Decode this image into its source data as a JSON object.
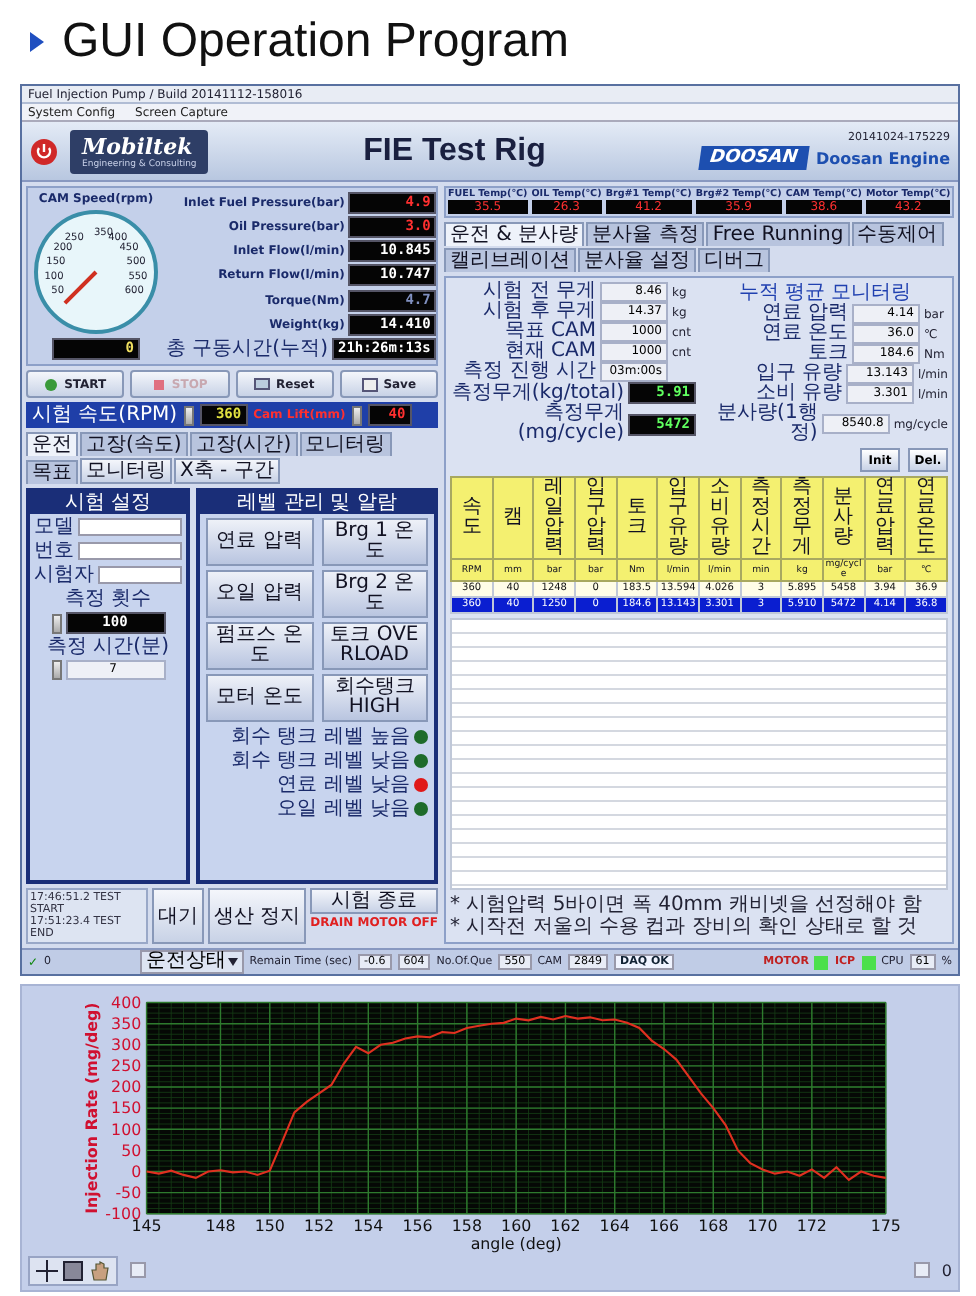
{
  "slide_title": "GUI Operation Program",
  "window": {
    "title": "Fuel Injection Pump / Build 20141112-158016",
    "menu": [
      "System Config",
      "Screen Capture"
    ],
    "brand": "Mobiltek",
    "brand_sub": "Engineering & Consulting",
    "heading": "FIE Test Rig",
    "partner_logo": "DOOSAN",
    "partner": "Doosan Engine",
    "timestamp": "20141024-175229"
  },
  "gauge": {
    "label": "CAM Speed(rpm)",
    "ticks": [
      "350",
      "250",
      "400",
      "200",
      "450",
      "150",
      "500",
      "100",
      "550",
      "50",
      "600"
    ],
    "reading": "0"
  },
  "readouts": [
    {
      "label": "Inlet Fuel Pressure(bar)",
      "value": "4.9",
      "kind": "warning"
    },
    {
      "label": "Oil Pressure(bar)",
      "value": "3.0",
      "kind": "warning"
    },
    {
      "label": "Inlet Flow(l/min)",
      "value": "10.845",
      "kind": "normal"
    },
    {
      "label": "Return Flow(l/min)",
      "value": "10.747",
      "kind": "normal"
    },
    {
      "label": "Torque(Nm)",
      "value": "4.7",
      "kind": "idle"
    },
    {
      "label": "Weight(kg)",
      "value": "14.410",
      "kind": "normal"
    }
  ],
  "run_time": {
    "label": "총 구동시간(누적)",
    "value": "21h:26m:13s"
  },
  "controls": [
    {
      "label": "START",
      "kind": "start",
      "disabled": false
    },
    {
      "label": "STOP",
      "kind": "stop",
      "disabled": true
    },
    {
      "label": "Reset",
      "kind": "reset",
      "disabled": false
    },
    {
      "label": "Save",
      "kind": "save",
      "disabled": false
    }
  ],
  "speed": {
    "label": "시험 속도(RPM)",
    "value": "360",
    "cam_label": "Cam Lift(mm)",
    "cam_value": "40"
  },
  "left_tabs": [
    {
      "label": "운전",
      "selected": true
    },
    {
      "label": "고장(속도)",
      "selected": false
    },
    {
      "label": "고장(시간)",
      "selected": false
    },
    {
      "label": "모니터링",
      "selected": false
    },
    {
      "label": "목표",
      "selected": false
    }
  ],
  "left_buttons": [
    "모니터링",
    "X축 - 구간"
  ],
  "test_setup": {
    "title": "시험 설정",
    "fields": [
      "모델",
      "번호",
      "시험자"
    ],
    "count_label": "측정 횟수",
    "count": "100",
    "time_label": "측정 시간(분)",
    "time": "7"
  },
  "alarms": {
    "title": "레벨 관리 및 알람",
    "buttons": [
      "연료 압력",
      "Brg 1 온도",
      "오일 압력",
      "Brg 2 온도",
      "펌프스 온도",
      "토크 OVERLOAD",
      "모터 온도",
      "회수탱크 HIGH"
    ],
    "lamps": [
      {
        "label": "회수 탱크 레벨 높음",
        "color": "#1e6b2a"
      },
      {
        "label": "회수 탱크 레벨 낮음",
        "color": "#1e6b2a"
      },
      {
        "label": "연료 레벨 낮음",
        "color": "#e01818"
      },
      {
        "label": "오일 레벨 낮음",
        "color": "#1e6b2a"
      }
    ]
  },
  "log": [
    "17:46:51.2 TEST START",
    "17:51:23.4 TEST END"
  ],
  "log_buttons": [
    "대기",
    "생산 정지"
  ],
  "finish_button": "시험 종료",
  "drain": "DRAIN MOTOR OFF",
  "temps": [
    {
      "label": "FUEL Temp(℃)",
      "value": "35.5"
    },
    {
      "label": "OIL Temp(℃)",
      "value": "26.3"
    },
    {
      "label": "Brg#1 Temp(℃)",
      "value": "41.2"
    },
    {
      "label": "Brg#2 Temp(℃)",
      "value": "35.9"
    },
    {
      "label": "CAM Temp(℃)",
      "value": "38.6"
    },
    {
      "label": "Motor Temp(℃)",
      "value": "43.2"
    }
  ],
  "right_tabs": [
    {
      "label": "운전 & 분사량",
      "selected": true
    },
    {
      "label": "분사율 측정",
      "selected": false
    },
    {
      "label": "Free Running",
      "selected": false
    },
    {
      "label": "수동제어",
      "selected": false
    },
    {
      "label": "캘리브레이션",
      "selected": false
    },
    {
      "label": "분사율 설정",
      "selected": false
    },
    {
      "label": "디버그",
      "selected": false
    }
  ],
  "measure": [
    {
      "label": "시험 전 무게",
      "value": "8.46",
      "unit": "kg"
    },
    {
      "label": "시험 후 무게",
      "value": "14.37",
      "unit": "kg"
    },
    {
      "label": "목표 CAM",
      "value": "1000",
      "unit": "cnt"
    },
    {
      "label": "현재 CAM",
      "value": "1000",
      "unit": "cnt"
    },
    {
      "label": "측정 진행 시간",
      "value": "03m:00s"
    }
  ],
  "results": [
    {
      "label": "측정무게(kg/total)",
      "value": "5.91"
    },
    {
      "label": "측정무게(mg/cycle)",
      "value": "5472"
    }
  ],
  "average": {
    "title": "누적 평균 모니터링",
    "rows": [
      {
        "label": "연료 압력",
        "value": "4.14",
        "unit": "bar"
      },
      {
        "label": "연료 온도",
        "value": "36.0",
        "unit": "℃"
      },
      {
        "label": "토크",
        "value": "184.6",
        "unit": "Nm"
      },
      {
        "label": "입구 유량",
        "value": "13.143",
        "unit": "l/min"
      },
      {
        "label": "소비 유량",
        "value": "3.301",
        "unit": "l/min"
      },
      {
        "label": "분사량(1행정)",
        "value": "8540.8",
        "unit": "mg/cycle"
      }
    ]
  },
  "table_buttons": [
    "Init",
    "Del."
  ],
  "table": {
    "columns": [
      {
        "name": "속도",
        "unit": "RPM"
      },
      {
        "name": "캠",
        "unit": "mm"
      },
      {
        "name": "레일압력",
        "unit": "bar"
      },
      {
        "name": "입구압력",
        "unit": "bar"
      },
      {
        "name": "토크",
        "unit": "Nm"
      },
      {
        "name": "입구유량",
        "unit": "l/min"
      },
      {
        "name": "소비유량",
        "unit": "l/min"
      },
      {
        "name": "측정시간",
        "unit": "min"
      },
      {
        "name": "측정무게",
        "unit": "kg"
      },
      {
        "name": "분사량",
        "unit": "mg/cycle"
      },
      {
        "name": "연료압력",
        "unit": "bar"
      },
      {
        "name": "연료온도",
        "unit": "℃"
      }
    ],
    "rows": [
      {
        "selected": false,
        "cells": [
          "360",
          "40",
          "1248",
          "0",
          "183.5",
          "13.594",
          "4.026",
          "3",
          "5.895",
          "5458",
          "3.94",
          "36.9"
        ]
      },
      {
        "selected": true,
        "cells": [
          "360",
          "40",
          "1250",
          "0",
          "184.6",
          "13.143",
          "3.301",
          "3",
          "5.910",
          "5472",
          "4.14",
          "36.8"
        ]
      }
    ]
  },
  "notes": [
    "* 시험압력 5바이면 폭 40mm 캐비넷을 선정해야 함",
    "* 시작전 저울의 수용 컵과 장비의 확인 상태로 할 것"
  ],
  "status_bar": {
    "state_menu": "운전상태",
    "remain_label": "Remain Time (sec)",
    "remain": "-0.6",
    "count": "604",
    "queue_label": "No.Of.Que",
    "queue": "550",
    "cam_label": "CAM",
    "cam": "2849",
    "daq": "DAQ OK",
    "lamps": [
      {
        "label": "MOTOR",
        "on": true
      },
      {
        "label": "ICP",
        "on": true
      }
    ],
    "cpu_label": "CPU",
    "cpu": "61",
    "cpu_unit": "%",
    "check_mark": "✓",
    "check": "0"
  },
  "plot": {
    "scroll_value": "0",
    "chart_data": {
      "type": "line",
      "grid": true,
      "xlabel": "angle (deg)",
      "ylabel": "Injection Rate (mg/deg)",
      "xlim": [
        145,
        175
      ],
      "ylim": [
        -100,
        400
      ],
      "xticks": [
        145,
        148,
        150,
        152,
        154,
        156,
        158,
        160,
        162,
        164,
        166,
        168,
        170,
        172,
        175
      ],
      "yticks": [
        -100,
        -50,
        0,
        50,
        100,
        150,
        200,
        250,
        300,
        350,
        400
      ],
      "x": [
        145,
        145.5,
        146,
        146.5,
        147,
        147.5,
        148,
        148.5,
        149,
        149.5,
        150,
        150.5,
        151,
        151.5,
        152,
        152.5,
        153,
        153.5,
        154,
        154.5,
        155,
        155.5,
        156,
        156.5,
        157,
        157.5,
        158,
        158.5,
        159,
        159.5,
        160,
        160.5,
        161,
        161.5,
        162,
        162.5,
        163,
        163.5,
        164,
        164.5,
        165,
        165.5,
        166,
        166.5,
        167,
        167.5,
        168,
        168.5,
        169,
        169.5,
        170,
        170.5,
        171,
        171.5,
        172,
        172.5,
        173,
        173.5,
        174,
        174.5,
        175
      ],
      "series": [
        {
          "color": "#e03020",
          "values": [
            0,
            -5,
            2,
            -8,
            -15,
            0,
            3,
            -2,
            0,
            -8,
            2,
            70,
            140,
            165,
            185,
            205,
            255,
            295,
            280,
            300,
            305,
            315,
            320,
            318,
            330,
            328,
            340,
            345,
            350,
            352,
            362,
            358,
            366,
            360,
            368,
            362,
            365,
            358,
            360,
            352,
            340,
            310,
            290,
            265,
            225,
            185,
            150,
            110,
            50,
            20,
            5,
            -5,
            0,
            -10,
            5,
            -15,
            10,
            -20,
            0,
            -10,
            -15
          ]
        }
      ]
    }
  }
}
